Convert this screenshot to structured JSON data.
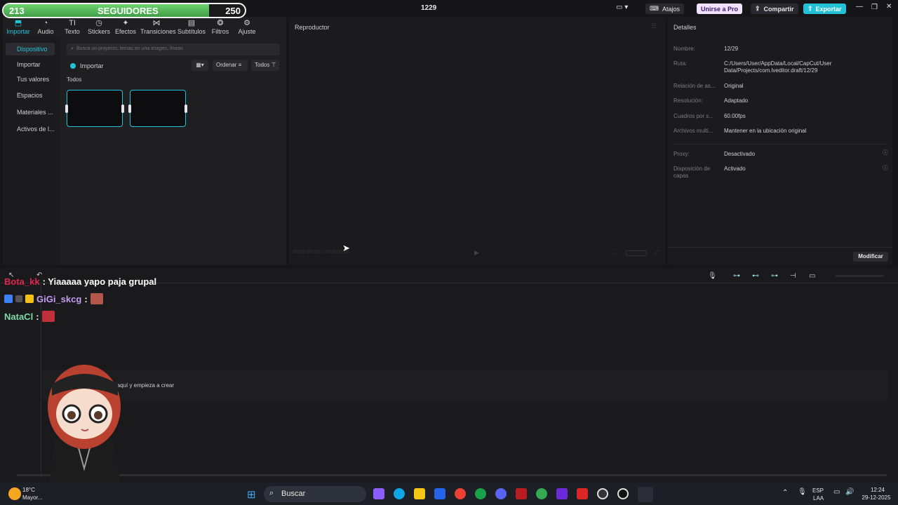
{
  "overlay": {
    "followers_current": "213",
    "followers_label": "SEGUIDORES",
    "followers_goal": "250",
    "followers_progress": 0.852
  },
  "titlebar": {
    "project_name": "1229",
    "shortcuts_label": "Atajos",
    "pro_label": "Unirse a Pro",
    "share_label": "Compartir",
    "export_label": "Exportar"
  },
  "toolbar": {
    "items": [
      {
        "label": "Importar",
        "icon": "import-icon"
      },
      {
        "label": "Audio",
        "icon": "audio-icon"
      },
      {
        "label": "Texto",
        "icon": "text-icon"
      },
      {
        "label": "Stickers",
        "icon": "sticker-icon"
      },
      {
        "label": "Efectos",
        "icon": "effects-icon"
      },
      {
        "label": "Transiciones",
        "icon": "transitions-icon"
      },
      {
        "label": "Subtítulos",
        "icon": "subtitles-icon"
      },
      {
        "label": "Filtros",
        "icon": "filters-icon"
      },
      {
        "label": "Ajuste",
        "icon": "adjust-icon"
      }
    ]
  },
  "sidebar": {
    "items": [
      {
        "label": "Dispositivo"
      },
      {
        "label": "Importar"
      },
      {
        "label": "Tus valores ..."
      },
      {
        "label": "Espacios"
      },
      {
        "label": "Materiales ..."
      },
      {
        "label": "Activos de l..."
      }
    ]
  },
  "media": {
    "search_placeholder": "Busca un proyecto, temas en una imagen, líneas",
    "import_label": "Importar",
    "sort_label": "Ordenar",
    "filter_label": "Todos",
    "section_label": "Todos"
  },
  "player": {
    "title": "Reproductor",
    "timecode": "00:00:00:00 / 00:00:00:00"
  },
  "details": {
    "title": "Detalles",
    "rows": [
      {
        "key": "Nombre:",
        "value": "12/29"
      },
      {
        "key": "Ruta:",
        "value": "C:/Users/User/AppData/Local/CapCut/User Data/Projects/com.lveditor.draft/12/29"
      },
      {
        "key": "Relación de as...",
        "value": "Original"
      },
      {
        "key": "Resolución:",
        "value": "Adaptado"
      },
      {
        "key": "Cuadros por s...",
        "value": "60.00fps"
      },
      {
        "key": "Archivos multi...",
        "value": "Mantener en la ubicación original"
      },
      {
        "key": "Proxy:",
        "value": "Desactivado"
      },
      {
        "key": "Disposición de capas",
        "value": "Activado"
      }
    ],
    "modify_label": "Modificar"
  },
  "timeline": {
    "hint": "...aquí y empieza a crear"
  },
  "chat": {
    "messages": [
      {
        "user": "Bota_kk",
        "text": ": Yiaaaaa yapo paja grupal",
        "color": "#e0244b"
      },
      {
        "user": "GiGi_skcg",
        "text": ":",
        "color": "#c59cf5"
      },
      {
        "user": "NataCl",
        "text": ":",
        "color": "#7fd8a8"
      }
    ]
  },
  "taskbar": {
    "weather_temp": "18°C",
    "weather_desc": "Mayor...",
    "search_label": "Buscar",
    "lang_1": "ESP",
    "lang_2": "LAA",
    "time": "12:24",
    "date": "29-12-2025"
  },
  "colors": {
    "accent": "#21c2d6",
    "panel": "#1f1f22",
    "background": "#161618"
  }
}
